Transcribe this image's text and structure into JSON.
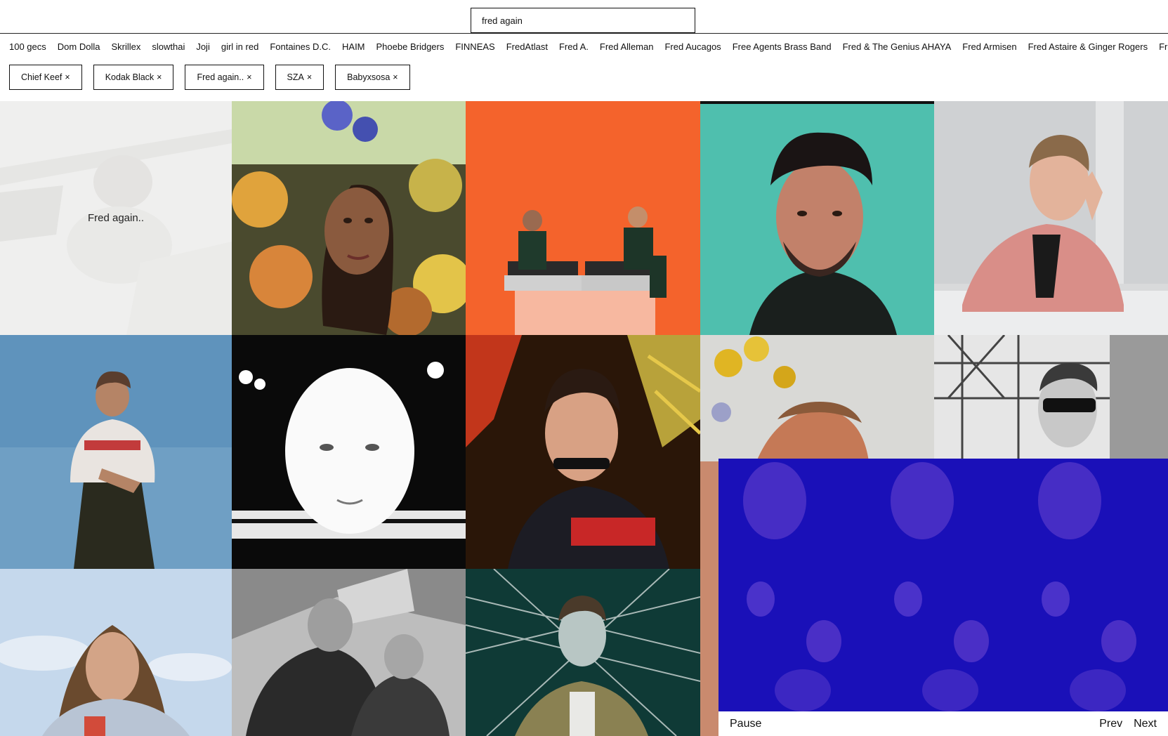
{
  "search": {
    "value": "fred again"
  },
  "suggestions": [
    "100 gecs",
    "Dom Dolla",
    "Skrillex",
    "slowthai",
    "Joji",
    "girl in red",
    "Fontaines D.C.",
    "HAIM",
    "Phoebe Bridgers",
    "FINNEAS",
    "FredAtlast",
    "Fred A.",
    "Fred Alleman",
    "Fred Aucagos",
    "Free Agents Brass Band",
    "Fred & The Genius AHAYA",
    "Fred Armisen",
    "Fred Astaire & Ginger Rogers",
    "Fred S"
  ],
  "chips": [
    {
      "label": "Chief Keef",
      "x": "×"
    },
    {
      "label": "Kodak Black",
      "x": "×"
    },
    {
      "label": "Fred again..",
      "x": "×"
    },
    {
      "label": "SZA",
      "x": "×"
    },
    {
      "label": "Babyxsosa",
      "x": "×"
    }
  ],
  "grid": {
    "highlight_label": "Fred again.."
  },
  "player": {
    "pause": "Pause",
    "prev": "Prev",
    "next": "Next"
  },
  "colors": {
    "accent_video": "#1a10b8",
    "tile_orange": "#f4632c",
    "tile_teal": "#4fbfae"
  }
}
